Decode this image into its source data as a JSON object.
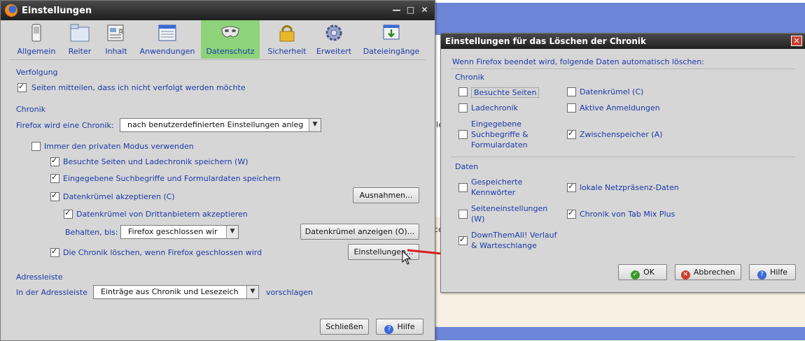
{
  "main": {
    "title": "Einstellungen",
    "tabs": [
      {
        "label": "Allgemein"
      },
      {
        "label": "Reiter"
      },
      {
        "label": "Inhalt"
      },
      {
        "label": "Anwendungen"
      },
      {
        "label": "Datenschutz"
      },
      {
        "label": "Sicherheit"
      },
      {
        "label": "Erweitert"
      },
      {
        "label": "Dateieingänge"
      }
    ],
    "selected_tab": "Datenschutz",
    "tracking": {
      "heading": "Verfolgung",
      "dnt_label": "Seiten mitteilen, dass ich nicht verfolgt werden möchte",
      "dnt_checked": true
    },
    "history": {
      "heading": "Chronik",
      "mode_label": "Firefox wird eine Chronik:",
      "mode_value": "nach benutzerdefinierten Einstellungen anleg",
      "private_label": "Immer den privaten Modus verwenden",
      "private_checked": false,
      "visited_label": "Besuchte Seiten und Ladechronik speichern (W)",
      "visited_checked": true,
      "search_label": "Eingegebene Suchbegriffe und Formulardaten speichern",
      "search_checked": true,
      "cookies_label": "Datenkrümel akzeptieren (C)",
      "cookies_checked": true,
      "exceptions_button": "Ausnahmen...",
      "third_party_label": "Datenkrümel von Drittanbietern akzeptieren",
      "third_party_checked": true,
      "keep_label": "Behalten, bis:",
      "keep_value": "Firefox geschlossen wir",
      "show_cookies_button": "Datenkrümel anzeigen (O)...",
      "clear_on_close_label": "Die Chronik löschen, wenn Firefox geschlossen wird",
      "clear_on_close_checked": true,
      "settings_button": "Einstellungen..."
    },
    "location_bar": {
      "heading": "Adressleiste",
      "label": "In der Adressleiste",
      "value": "Einträge aus Chronik und Lesezeich",
      "suffix": "vorschlagen"
    },
    "close_button": "Schließen",
    "help_button": "Hilfe"
  },
  "dialog": {
    "title": "Einstellungen für das Löschen der Chronik",
    "intro": "Wenn Firefox beendet wird, folgende Daten automatisch löschen:",
    "history_heading": "Chronik",
    "history_items": [
      {
        "label": "Besuchte Seiten",
        "checked": false
      },
      {
        "label": "Datenkrümel (C)",
        "checked": false
      },
      {
        "label": "Ladechronik",
        "checked": false
      },
      {
        "label": "Aktive Anmeldungen",
        "checked": false
      },
      {
        "label": "Eingegebene Suchbegriffe & Formulardaten",
        "checked": false
      },
      {
        "label": "Zwischenspeicher (A)",
        "checked": true
      }
    ],
    "data_heading": "Daten",
    "data_items": [
      {
        "label": "Gespeicherte Kennwörter",
        "checked": false
      },
      {
        "label": "lokale Netzpräsenz-Daten",
        "checked": true
      },
      {
        "label": "Seiteneinstellungen (W)",
        "checked": false
      },
      {
        "label": "Chronik von Tab Mix Plus",
        "checked": true
      },
      {
        "label": "DownThemAll! Verlauf & Warteschlange",
        "checked": true
      }
    ],
    "ok_button": "OK",
    "cancel_button": "Abbrechen",
    "help_button": "Hilfe"
  },
  "background_text": {
    "frag1": "lle",
    "frag2": "ce"
  },
  "colors": {
    "label_blue": "#1a3aa8",
    "selected_tab": "#8ed27a",
    "arrow_red": "#d81e1e"
  }
}
